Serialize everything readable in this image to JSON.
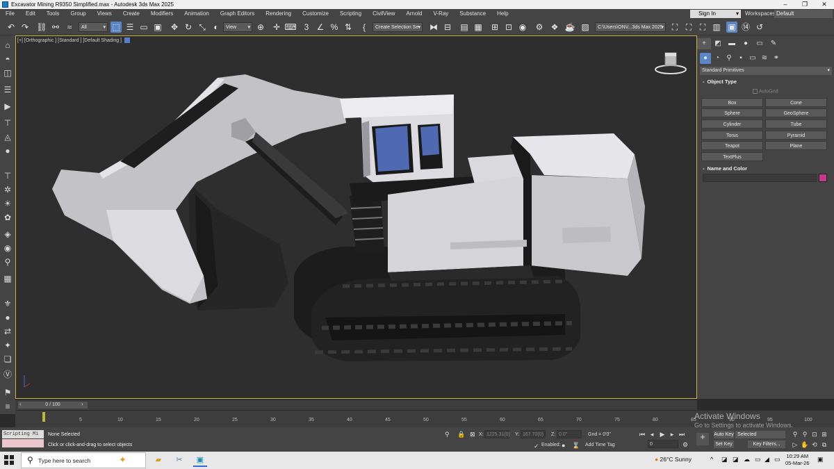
{
  "window": {
    "title": "Excavator Mining R9350 Simplified.max - Autodesk 3ds Max 2025",
    "minimize": "–",
    "maximize": "❐",
    "close": "✕"
  },
  "menu": [
    "File",
    "Edit",
    "Tools",
    "Group",
    "Views",
    "Create",
    "Modifiers",
    "Animation",
    "Graph Editors",
    "Rendering",
    "Customize",
    "Scripting",
    "CivilView",
    "Arnold",
    "V-Ray",
    "Substance",
    "Help"
  ],
  "account": {
    "signin": "Sign In",
    "workspaces_label": "Workspaces:",
    "workspace": "Default"
  },
  "toolbar": {
    "filter": "All",
    "ref_coord": "View",
    "selection_set": "Create Selection Se",
    "project_path": "C:\\Users\\ONV...3ds Max 2025",
    "angle_snap_value": "3"
  },
  "viewport": {
    "label": "[+] [Orthographic ] [Standard ] [Default Shading ]"
  },
  "command_panel": {
    "category": "Standard Primitives",
    "object_type_title": "Object Type",
    "autogrid": "AutoGrid",
    "buttons": [
      "Box",
      "Cone",
      "Sphere",
      "GeoSphere",
      "Cylinder",
      "Tube",
      "Torus",
      "Pyramid",
      "Teapot",
      "Plane",
      "TextPlus"
    ],
    "name_color_title": "Name and Color",
    "object_color": "#c23b8a"
  },
  "timeline": {
    "slider_label": "0 / 100",
    "ticks": [
      "5",
      "10",
      "15",
      "20",
      "25",
      "30",
      "35",
      "40",
      "45",
      "50",
      "55",
      "60",
      "65",
      "70",
      "75",
      "80",
      "85",
      "90",
      "95",
      "100"
    ]
  },
  "status": {
    "scripting": "Scripting Mi",
    "selection": "None Selected",
    "prompt": "Click or click-and-drag to select objects",
    "x_label": "X:",
    "x_value": "1225.31(0)",
    "y_label": "Y:",
    "y_value": "167.70(0)",
    "z_label": "Z:",
    "z_value": "0.0\"",
    "grid": "Gnd = 0'0\"",
    "enabled": "Enabled:",
    "add_time_tag": "Add Time Tag",
    "frame_value": "0",
    "auto_key": "Auto Key",
    "set_key": "Set Key",
    "key_mode": "Selected",
    "key_filters": "Key Filters..."
  },
  "watermark": {
    "line1": "Activate Windows",
    "line2": "Go to Settings to activate Windows."
  },
  "taskbar": {
    "search": "Type here to search",
    "weather_temp": "26°C",
    "weather_desc": "Sunny",
    "time": "10:29 AM",
    "date": "05-Mar-26"
  }
}
